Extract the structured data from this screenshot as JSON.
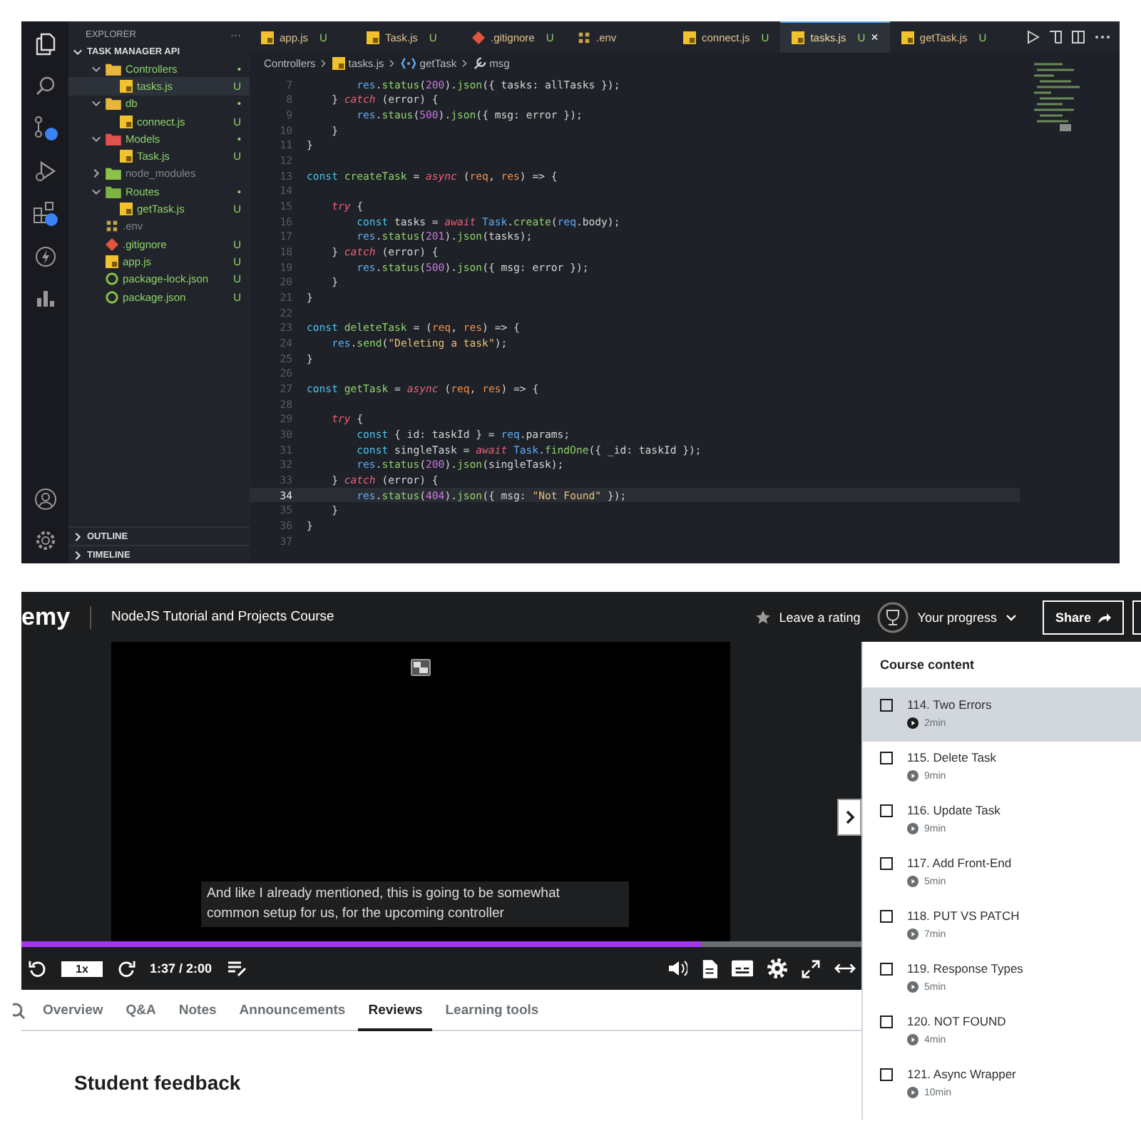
{
  "editor": {
    "explorer": {
      "title": "EXPLORER",
      "more": "···",
      "project": {
        "label": "TASK MANAGER API",
        "expanded": true
      },
      "tree": [
        {
          "label": "Controllers",
          "kind": "folder",
          "color": "#e8b63a",
          "status": "•",
          "ignored": false,
          "selected": false,
          "expanded": true,
          "children": [
            {
              "label": "tasks.js",
              "kind": "js",
              "status": "U",
              "ignored": false,
              "selected": true
            }
          ]
        },
        {
          "label": "db",
          "kind": "folder",
          "color": "#e8b63a",
          "status": "•",
          "ignored": false,
          "selected": false,
          "expanded": true,
          "children": [
            {
              "label": "connect.js",
              "kind": "js",
              "status": "U",
              "ignored": false,
              "selected": false
            }
          ]
        },
        {
          "label": "Models",
          "kind": "folder",
          "color": "#e0524f",
          "status": "•",
          "ignored": false,
          "selected": false,
          "expanded": true,
          "children": [
            {
              "label": "Task.js",
              "kind": "js",
              "status": "U",
              "ignored": false,
              "selected": false
            }
          ]
        },
        {
          "label": "node_modules",
          "kind": "folder",
          "color": "#8bc34a",
          "ignored": true,
          "selected": false,
          "expanded": false
        },
        {
          "label": "Routes",
          "kind": "folder",
          "color": "#7cb342",
          "status": "•",
          "ignored": false,
          "selected": false,
          "expanded": true,
          "children": [
            {
              "label": "getTask.js",
              "kind": "js",
              "status": "U",
              "ignored": false,
              "selected": false
            }
          ]
        },
        {
          "label": ".env",
          "kind": "env",
          "ignored": true,
          "selected": false
        },
        {
          "label": ".gitignore",
          "kind": "git",
          "status": "U",
          "ignored": false,
          "selected": false
        },
        {
          "label": "app.js",
          "kind": "js",
          "status": "U",
          "ignored": false,
          "selected": false
        },
        {
          "label": "package-lock.json",
          "kind": "json",
          "status": "U",
          "ignored": false,
          "selected": false
        },
        {
          "label": "package.json",
          "kind": "json",
          "status": "U",
          "ignored": false,
          "selected": false
        }
      ],
      "sections": [
        {
          "label": "OUTLINE",
          "expanded": false
        },
        {
          "label": "TIMELINE",
          "expanded": false
        }
      ]
    },
    "tabs": [
      {
        "label": "app.js",
        "kind": "js",
        "status": "U",
        "selected": false
      },
      {
        "label": "Task.js",
        "kind": "js",
        "status": "U",
        "selected": false
      },
      {
        "label": ".gitignore",
        "kind": "git",
        "status": "U",
        "selected": false
      },
      {
        "label": ".env",
        "kind": "env",
        "selected": false
      },
      {
        "label": "connect.js",
        "kind": "js",
        "status": "U",
        "selected": false
      },
      {
        "label": "tasks.js",
        "kind": "js",
        "status": "U",
        "selected": true,
        "close": "×"
      },
      {
        "label": "getTask.js",
        "kind": "js",
        "status": "U",
        "selected": false
      }
    ],
    "breadcrumb": [
      {
        "label": "Controllers",
        "kind": "text"
      },
      {
        "label": "tasks.js",
        "kind": "js"
      },
      {
        "label": "getTask",
        "kind": "method"
      },
      {
        "label": "msg",
        "kind": "property"
      }
    ],
    "code": [
      {
        "n": "7",
        "tokens": [
          {
            "text": "        res",
            "kind": "variable"
          },
          {
            "text": ".",
            "kind": "plain"
          },
          {
            "text": "status",
            "kind": "function"
          },
          {
            "text": "(",
            "kind": "plain"
          },
          {
            "text": "200",
            "kind": "number"
          },
          {
            "text": ").",
            "kind": "plain"
          },
          {
            "text": "json",
            "kind": "function"
          },
          {
            "text": "({ tasks: allTasks });",
            "kind": "plain"
          }
        ]
      },
      {
        "n": "8",
        "tokens": [
          {
            "text": "    } ",
            "kind": "plain"
          },
          {
            "text": "catch",
            "kind": "control"
          },
          {
            "text": " (error) {",
            "kind": "plain"
          }
        ]
      },
      {
        "n": "9",
        "tokens": [
          {
            "text": "        res",
            "kind": "variable"
          },
          {
            "text": ".",
            "kind": "plain"
          },
          {
            "text": "staus",
            "kind": "function"
          },
          {
            "text": "(",
            "kind": "plain"
          },
          {
            "text": "500",
            "kind": "number"
          },
          {
            "text": ").",
            "kind": "plain"
          },
          {
            "text": "json",
            "kind": "function"
          },
          {
            "text": "({ msg: error });",
            "kind": "plain"
          }
        ]
      },
      {
        "n": "10",
        "tokens": [
          {
            "text": "    }",
            "kind": "plain"
          }
        ]
      },
      {
        "n": "11",
        "tokens": [
          {
            "text": "}",
            "kind": "plain"
          }
        ]
      },
      {
        "n": "12"
      },
      {
        "n": "13",
        "tokens": [
          {
            "text": "const",
            "kind": "keyword"
          },
          {
            "text": " createTask ",
            "kind": "function"
          },
          {
            "text": "= ",
            "kind": "plain"
          },
          {
            "text": "async",
            "kind": "control"
          },
          {
            "text": " (",
            "kind": "plain"
          },
          {
            "text": "req",
            "kind": "param"
          },
          {
            "text": ", ",
            "kind": "plain"
          },
          {
            "text": "res",
            "kind": "param"
          },
          {
            "text": ") => {",
            "kind": "plain"
          }
        ]
      },
      {
        "n": "14"
      },
      {
        "n": "15",
        "tokens": [
          {
            "text": "    try",
            "kind": "control"
          },
          {
            "text": " {",
            "kind": "plain"
          }
        ]
      },
      {
        "n": "16",
        "tokens": [
          {
            "text": "        const",
            "kind": "keyword"
          },
          {
            "text": " tasks = ",
            "kind": "plain"
          },
          {
            "text": "await",
            "kind": "control"
          },
          {
            "text": " Task",
            "kind": "variable"
          },
          {
            "text": ".",
            "kind": "plain"
          },
          {
            "text": "create",
            "kind": "function"
          },
          {
            "text": "(",
            "kind": "plain"
          },
          {
            "text": "req",
            "kind": "variable"
          },
          {
            "text": ".body);",
            "kind": "plain"
          }
        ]
      },
      {
        "n": "17",
        "tokens": [
          {
            "text": "        res",
            "kind": "variable"
          },
          {
            "text": ".",
            "kind": "plain"
          },
          {
            "text": "status",
            "kind": "function"
          },
          {
            "text": "(",
            "kind": "plain"
          },
          {
            "text": "201",
            "kind": "number"
          },
          {
            "text": ").",
            "kind": "plain"
          },
          {
            "text": "json",
            "kind": "function"
          },
          {
            "text": "(tasks);",
            "kind": "plain"
          }
        ]
      },
      {
        "n": "18",
        "tokens": [
          {
            "text": "    } ",
            "kind": "plain"
          },
          {
            "text": "catch",
            "kind": "control"
          },
          {
            "text": " (error) {",
            "kind": "plain"
          }
        ]
      },
      {
        "n": "19",
        "tokens": [
          {
            "text": "        res",
            "kind": "variable"
          },
          {
            "text": ".",
            "kind": "plain"
          },
          {
            "text": "status",
            "kind": "function"
          },
          {
            "text": "(",
            "kind": "plain"
          },
          {
            "text": "500",
            "kind": "number"
          },
          {
            "text": ").",
            "kind": "plain"
          },
          {
            "text": "json",
            "kind": "function"
          },
          {
            "text": "({ msg: error });",
            "kind": "plain"
          }
        ]
      },
      {
        "n": "20",
        "tokens": [
          {
            "text": "    }",
            "kind": "plain"
          }
        ]
      },
      {
        "n": "21",
        "tokens": [
          {
            "text": "}",
            "kind": "plain"
          }
        ]
      },
      {
        "n": "22"
      },
      {
        "n": "23",
        "tokens": [
          {
            "text": "const",
            "kind": "keyword"
          },
          {
            "text": " deleteTask ",
            "kind": "function"
          },
          {
            "text": "= (",
            "kind": "plain"
          },
          {
            "text": "req",
            "kind": "param"
          },
          {
            "text": ", ",
            "kind": "plain"
          },
          {
            "text": "res",
            "kind": "param"
          },
          {
            "text": ") => {",
            "kind": "plain"
          }
        ]
      },
      {
        "n": "24",
        "tokens": [
          {
            "text": "    res",
            "kind": "variable"
          },
          {
            "text": ".",
            "kind": "plain"
          },
          {
            "text": "send",
            "kind": "function"
          },
          {
            "text": "(",
            "kind": "plain"
          },
          {
            "text": "\"Deleting a task\"",
            "kind": "string"
          },
          {
            "text": ");",
            "kind": "plain"
          }
        ]
      },
      {
        "n": "25",
        "tokens": [
          {
            "text": "}",
            "kind": "plain"
          }
        ]
      },
      {
        "n": "26"
      },
      {
        "n": "27",
        "tokens": [
          {
            "text": "const",
            "kind": "keyword"
          },
          {
            "text": " getTask ",
            "kind": "function"
          },
          {
            "text": "= ",
            "kind": "plain"
          },
          {
            "text": "async",
            "kind": "control"
          },
          {
            "text": " (",
            "kind": "plain"
          },
          {
            "text": "req",
            "kind": "param"
          },
          {
            "text": ", ",
            "kind": "plain"
          },
          {
            "text": "res",
            "kind": "param"
          },
          {
            "text": ") => {",
            "kind": "plain"
          }
        ]
      },
      {
        "n": "28"
      },
      {
        "n": "29",
        "tokens": [
          {
            "text": "    try",
            "kind": "control"
          },
          {
            "text": " {",
            "kind": "plain"
          }
        ]
      },
      {
        "n": "30",
        "tokens": [
          {
            "text": "        const",
            "kind": "keyword"
          },
          {
            "text": " { id: taskId } = ",
            "kind": "plain"
          },
          {
            "text": "req",
            "kind": "variable"
          },
          {
            "text": ".params;",
            "kind": "plain"
          }
        ]
      },
      {
        "n": "31",
        "tokens": [
          {
            "text": "        const",
            "kind": "keyword"
          },
          {
            "text": " singleTask = ",
            "kind": "plain"
          },
          {
            "text": "await",
            "kind": "control"
          },
          {
            "text": " Task",
            "kind": "variable"
          },
          {
            "text": ".",
            "kind": "plain"
          },
          {
            "text": "findOne",
            "kind": "function"
          },
          {
            "text": "({ _id: taskId });",
            "kind": "plain"
          }
        ]
      },
      {
        "n": "32",
        "tokens": [
          {
            "text": "        res",
            "kind": "variable"
          },
          {
            "text": ".",
            "kind": "plain"
          },
          {
            "text": "status",
            "kind": "function"
          },
          {
            "text": "(",
            "kind": "plain"
          },
          {
            "text": "200",
            "kind": "number"
          },
          {
            "text": ").",
            "kind": "plain"
          },
          {
            "text": "json",
            "kind": "function"
          },
          {
            "text": "(singleTask);",
            "kind": "plain"
          }
        ]
      },
      {
        "n": "33",
        "tokens": [
          {
            "text": "    } ",
            "kind": "plain"
          },
          {
            "text": "catch",
            "kind": "control"
          },
          {
            "text": " (error) {",
            "kind": "plain"
          }
        ]
      },
      {
        "n": "34",
        "current": true,
        "tokens": [
          {
            "text": "        res",
            "kind": "variable"
          },
          {
            "text": ".",
            "kind": "plain"
          },
          {
            "text": "status",
            "kind": "function"
          },
          {
            "text": "(",
            "kind": "plain"
          },
          {
            "text": "404",
            "kind": "number"
          },
          {
            "text": ").",
            "kind": "plain"
          },
          {
            "text": "json",
            "kind": "function"
          },
          {
            "text": "({ msg: ",
            "kind": "plain"
          },
          {
            "text": "\"Not Found\"",
            "kind": "string"
          },
          {
            "text": " });",
            "kind": "plain"
          }
        ]
      },
      {
        "n": "35",
        "tokens": [
          {
            "text": "    }",
            "kind": "plain"
          }
        ]
      },
      {
        "n": "36",
        "tokens": [
          {
            "text": "}",
            "kind": "plain"
          }
        ]
      },
      {
        "n": "37"
      }
    ]
  },
  "player": {
    "logo": "emy",
    "course_title": "NodeJS Tutorial and Projects Course",
    "rating_link": "Leave a rating",
    "progress_button": "Your progress",
    "share_button": "Share",
    "caption": [
      "And like I already mentioned, this is going to be somewhat",
      "common setup for us, for the upcoming controller"
    ],
    "progress": {
      "level": 0.81
    },
    "speed": "1x",
    "time": "1:37 / 2:00",
    "tabs": [
      {
        "label": "Overview",
        "selected": false
      },
      {
        "label": "Q&A",
        "selected": false
      },
      {
        "label": "Notes",
        "selected": false
      },
      {
        "label": "Announcements",
        "selected": false
      },
      {
        "label": "Reviews",
        "selected": true
      },
      {
        "label": "Learning tools",
        "selected": false
      }
    ],
    "section_heading": "Student feedback",
    "course_content": {
      "title": "Course content",
      "items": [
        {
          "title": "114. Two Errors",
          "duration": "2min",
          "checked": false,
          "selected": true
        },
        {
          "title": "115. Delete Task",
          "duration": "9min",
          "checked": false,
          "selected": false
        },
        {
          "title": "116. Update Task",
          "duration": "9min",
          "checked": false,
          "selected": false
        },
        {
          "title": "117. Add Front-End",
          "duration": "5min",
          "checked": false,
          "selected": false
        },
        {
          "title": "118. PUT VS PATCH",
          "duration": "7min",
          "checked": false,
          "selected": false
        },
        {
          "title": "119. Response Types",
          "duration": "5min",
          "checked": false,
          "selected": false
        },
        {
          "title": "120. NOT FOUND",
          "duration": "4min",
          "checked": false,
          "selected": false
        },
        {
          "title": "121. Async Wrapper",
          "duration": "10min",
          "checked": false,
          "selected": false
        }
      ]
    }
  }
}
